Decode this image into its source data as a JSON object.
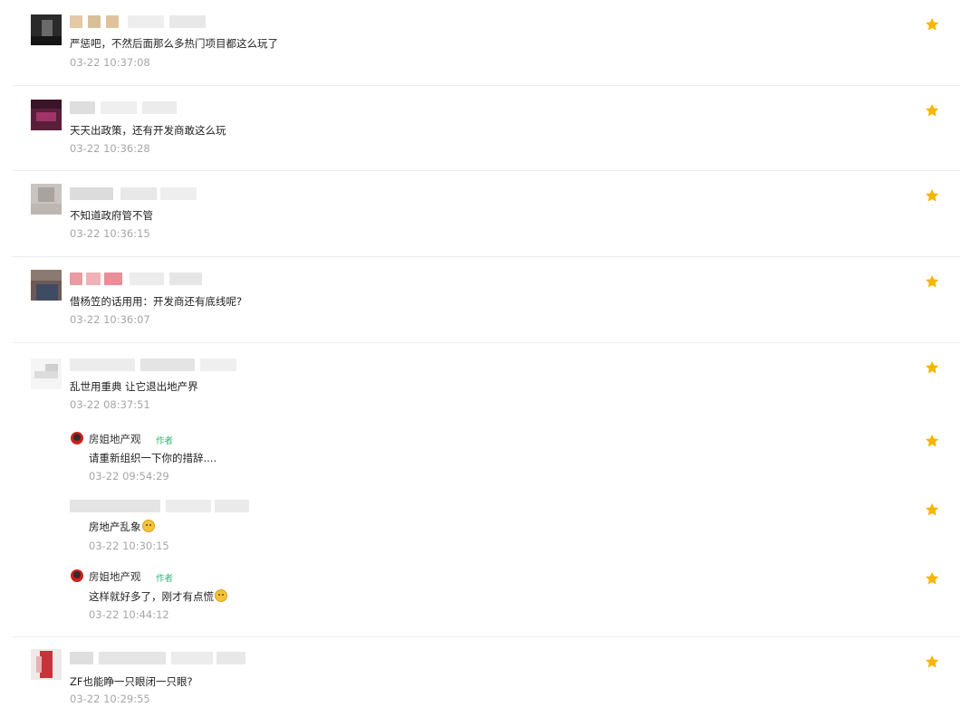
{
  "comments": [
    {
      "text": "严惩吧，不然后面那么多热门项目都这么玩了",
      "time": "03-22 10:37:08"
    },
    {
      "text": "天天出政策，还有开发商敢这么玩",
      "time": "03-22 10:36:28"
    },
    {
      "text": "不知道政府管不管",
      "time": "03-22 10:36:15"
    },
    {
      "text": "借杨笠的话用用：开发商还有底线呢?",
      "time": "03-22 10:36:07"
    },
    {
      "text": "乱世用重典 让它退出地产界",
      "time": "03-22 08:37:51"
    },
    {
      "text": "ZF也能睁一只眼闭一只眼?",
      "time": "03-22 10:29:55"
    }
  ],
  "replies": [
    {
      "name": "房姐地产观",
      "badge": "作者",
      "text": "请重新组织一下你的措辞....",
      "time": "03-22 09:54:29"
    },
    {
      "text": "房地产乱象",
      "time": "03-22 10:30:15"
    },
    {
      "name": "房姐地产观",
      "badge": "作者",
      "text": "这样就好多了，刚才有点慌",
      "time": "03-22 10:44:12"
    }
  ],
  "icons": {
    "like": "star-icon",
    "emoji": "smiling-face-emoji"
  },
  "colors": {
    "star": "#f7b500",
    "author_badge": "#2bb673",
    "timestamp": "#a6a6a6"
  }
}
